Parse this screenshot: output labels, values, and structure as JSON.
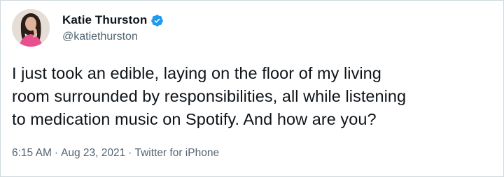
{
  "tweet": {
    "author": {
      "display_name": "Katie Thurston",
      "handle": "@katiethurston",
      "verified": true,
      "avatar_icon": "profile-photo"
    },
    "text": "I just took an edible, laying on the floor of my living\nroom surrounded by responsibilities, all while listening\nto medication music on Spotify. And how are you?",
    "time": "6:15 AM",
    "date": "Aug 23, 2021",
    "source": "Twitter for iPhone",
    "separator": "·"
  },
  "colors": {
    "verified_blue": "#1d9bf0",
    "secondary_text": "#536471",
    "primary_text": "#0f1419",
    "border": "#cfd9de"
  }
}
